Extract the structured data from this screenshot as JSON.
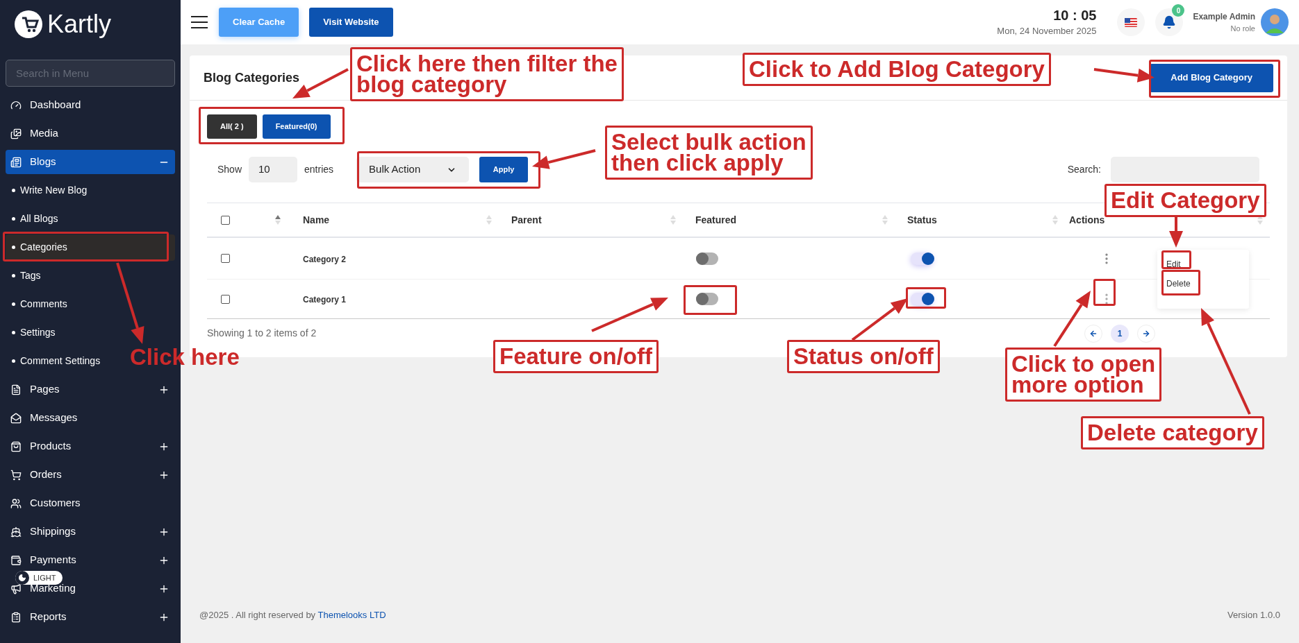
{
  "brand": {
    "name": "Kartly"
  },
  "sidebar": {
    "search": {
      "placeholder": "Search in Menu"
    },
    "items": [
      {
        "label": "Dashboard",
        "kind": "link",
        "selected": false
      },
      {
        "label": "Media",
        "kind": "link",
        "selected": false
      },
      {
        "label": "Blogs",
        "kind": "group",
        "expanded": true,
        "selected": true,
        "children": [
          {
            "label": "Write New Blog",
            "selected": false
          },
          {
            "label": "All Blogs",
            "selected": false
          },
          {
            "label": "Categories",
            "selected": true
          },
          {
            "label": "Tags",
            "selected": false
          },
          {
            "label": "Comments",
            "selected": false
          },
          {
            "label": "Settings",
            "selected": false
          },
          {
            "label": "Comment Settings",
            "selected": false
          }
        ]
      },
      {
        "label": "Pages",
        "kind": "group",
        "expanded": false,
        "selected": false
      },
      {
        "label": "Messages",
        "kind": "link",
        "selected": false
      },
      {
        "label": "Products",
        "kind": "group",
        "expanded": false,
        "selected": false
      },
      {
        "label": "Orders",
        "kind": "group",
        "expanded": false,
        "selected": false
      },
      {
        "label": "Customers",
        "kind": "link",
        "selected": false
      },
      {
        "label": "Shippings",
        "kind": "group",
        "expanded": false,
        "selected": false
      },
      {
        "label": "Payments",
        "kind": "group",
        "expanded": false,
        "selected": false
      },
      {
        "label": "Marketing",
        "kind": "group",
        "expanded": false,
        "selected": false
      },
      {
        "label": "Reports",
        "kind": "group",
        "expanded": false,
        "selected": false
      }
    ],
    "theme_toggle": {
      "label": "LIGHT"
    }
  },
  "topbar": {
    "buttons": [
      {
        "label": "Clear Cache",
        "kind": "light"
      },
      {
        "label": "Visit Website",
        "kind": "primary"
      }
    ],
    "time": "10 : 05",
    "date": "Mon, 24 November 2025",
    "notifications": {
      "count": "0"
    },
    "user": {
      "name": "Example Admin",
      "role": "No role"
    }
  },
  "page": {
    "title": "Blog Categories",
    "add_button": "Add Blog Category",
    "filters": [
      {
        "label": "All( 2 )",
        "selected": true
      },
      {
        "label": "Featured(0)",
        "selected": false
      }
    ],
    "show": {
      "label": "Show",
      "value": "10",
      "suffix": "entries"
    },
    "bulk": {
      "value": "Bulk Action",
      "apply": "Apply"
    },
    "search": {
      "label": "Search:"
    },
    "table": {
      "select_all": {
        "checked": false
      },
      "columns": [
        "Name",
        "Parent",
        "Featured",
        "Status",
        "Actions"
      ],
      "rows": [
        {
          "checked": false,
          "name": "Category 2",
          "featured": false,
          "status": true,
          "menu_open": true
        },
        {
          "checked": false,
          "name": "Category 1",
          "featured": false,
          "status": true,
          "menu_open": false
        }
      ]
    },
    "action_menu": [
      "Edit",
      "Delete"
    ],
    "info": "Showing 1 to 2 items of 2",
    "pagination": [
      {
        "label": "1",
        "selected": true
      }
    ]
  },
  "footer": {
    "copyright": "@2025 . All right reserved by",
    "company": "Themelooks LTD",
    "version": "Version 1.0.0"
  },
  "annotations": [
    {
      "lines": [
        "Click here then filter the",
        "blog category"
      ],
      "boxed": true
    },
    {
      "lines": [
        "Click to Add Blog Category"
      ],
      "boxed": true
    },
    {
      "lines": [
        "Select bulk action",
        "then click apply"
      ],
      "boxed": true
    },
    {
      "lines": [
        "Edit Category"
      ],
      "boxed": true
    },
    {
      "lines": [
        "Click here"
      ],
      "boxed": false
    },
    {
      "lines": [
        "Feature on/off"
      ],
      "boxed": true
    },
    {
      "lines": [
        "Status on/off"
      ],
      "boxed": true
    },
    {
      "lines": [
        "Click to open",
        "more option"
      ],
      "boxed": true
    },
    {
      "lines": [
        "Delete category"
      ],
      "boxed": true
    }
  ]
}
